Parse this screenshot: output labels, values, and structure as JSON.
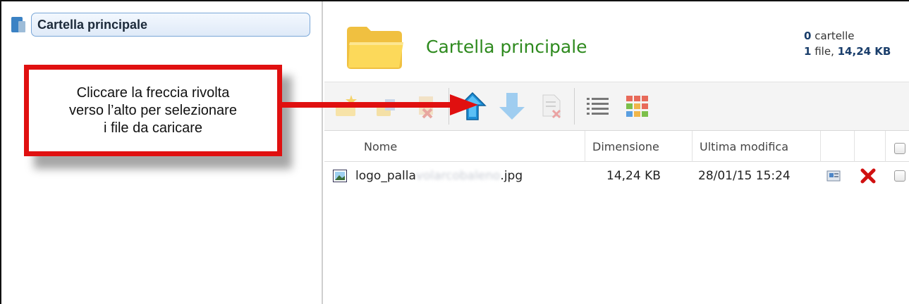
{
  "tree": {
    "root_label": "Cartella principale"
  },
  "header": {
    "folder_title": "Cartella principale",
    "folders_count": "0",
    "folders_label": "cartelle",
    "files_count": "1",
    "files_label": "file,",
    "total_size": "14,24 KB"
  },
  "toolbar": {
    "buttons": [
      "new-folder-icon",
      "move-icon",
      "delete-icon",
      "upload-icon",
      "download-icon",
      "remove-file-icon",
      "list-view-icon",
      "grid-view-icon"
    ]
  },
  "columns": {
    "name": "Nome",
    "size": "Dimensione",
    "modified": "Ultima modifica"
  },
  "files": [
    {
      "name_visible": "logo_palla",
      "name_blurred": "volarcobaleno",
      "extension": ".jpg",
      "size": "14,24 KB",
      "modified": "28/01/15 15:24"
    }
  ],
  "callout": {
    "text": "Cliccare la freccia rivolta\nverso l’alto per selezionare\ni file da caricare"
  },
  "colors": {
    "callout_border": "#e01010",
    "title_green": "#2e8a1e",
    "upload_blue": "#1e8fd6"
  }
}
